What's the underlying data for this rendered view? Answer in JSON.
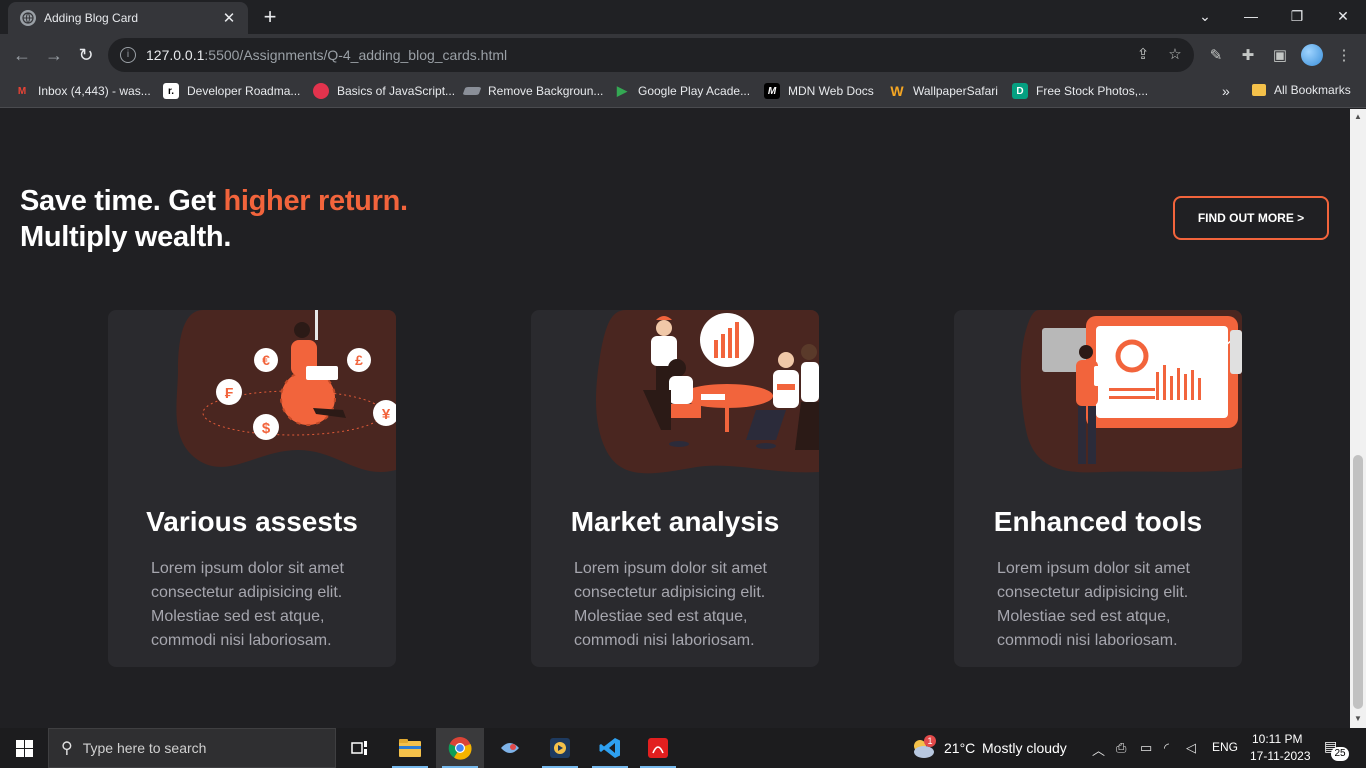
{
  "browser": {
    "tab_title": "Adding Blog Card",
    "new_tab": "+",
    "url_host": "127.0.0.1",
    "url_rest": ":5500/Assignments/Q-4_adding_blog_cards.html"
  },
  "bookmarks": [
    {
      "label": "Inbox (4,443) - was...",
      "icon": "gmail-icon",
      "color": "#ea4335"
    },
    {
      "label": "Developer Roadma...",
      "icon": "roadmap-icon",
      "color": "#ffffff"
    },
    {
      "label": "Basics of JavaScript...",
      "icon": "js-basics-icon",
      "color": "#e2334d"
    },
    {
      "label": "Remove Backgroun...",
      "icon": "removebg-icon",
      "color": "#8a8f98"
    },
    {
      "label": "Google Play Acade...",
      "icon": "google-play-icon",
      "color": "#34a853"
    },
    {
      "label": "MDN Web Docs",
      "icon": "mdn-icon",
      "color": "#000000"
    },
    {
      "label": "WallpaperSafari",
      "icon": "wallpapersafari-icon",
      "color": "#f5a623"
    },
    {
      "label": "Free Stock Photos,...",
      "icon": "stock-photos-icon",
      "color": "#05a081"
    }
  ],
  "bookmarks_overflow": "»",
  "all_bookmarks": "All Bookmarks",
  "hero": {
    "title_part1": "Save time. Get ",
    "title_accent": "higher return.",
    "title_part2": "Multiply wealth.",
    "cta_label": "FIND OUT MORE >"
  },
  "colors": {
    "accent": "#f2643c",
    "background": "#202023",
    "card": "#2a2a2e",
    "illustration_blob": "#4a2620"
  },
  "cards": [
    {
      "title": "Various assests",
      "text": "Lorem ipsum dolor sit amet consectetur adipisicing elit. Molestiae sed est atque, commodi nisi laboriosam."
    },
    {
      "title": "Market analysis",
      "text": "Lorem ipsum dolor sit amet consectetur adipisicing elit. Molestiae sed est atque, commodi nisi laboriosam."
    },
    {
      "title": "Enhanced tools",
      "text": "Lorem ipsum dolor sit amet consectetur adipisicing elit. Molestiae sed est atque, commodi nisi laboriosam."
    }
  ],
  "currency_symbols": [
    "€",
    "£",
    "₣",
    "$",
    "¥"
  ],
  "taskbar": {
    "search_placeholder": "Type here to search",
    "weather_temp": "21°C",
    "weather_desc": "Mostly cloudy",
    "weather_badge": "1",
    "language": "ENG",
    "time": "10:11 PM",
    "date": "17-11-2023",
    "notifications": "25"
  }
}
